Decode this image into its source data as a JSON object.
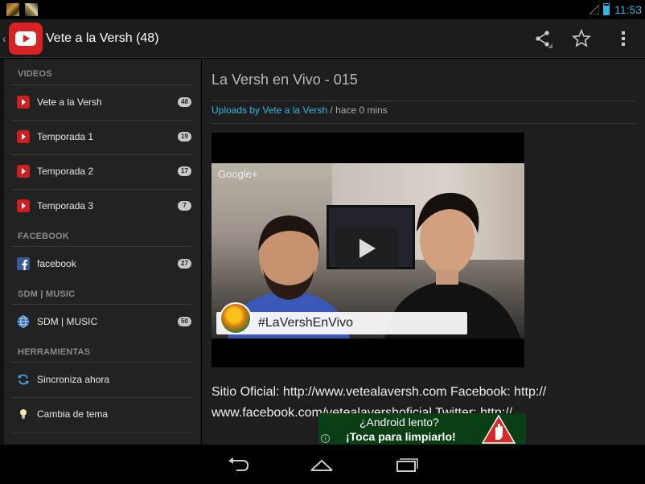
{
  "status_bar": {
    "time": "11:53",
    "notification_icons": [
      "app-notification-icon",
      "gallery-notification-icon"
    ],
    "signal_icon": "signal-icon",
    "battery_icon": "battery-icon"
  },
  "action_bar": {
    "back_icon": "chevron-left-icon",
    "app_icon": "youtube-logo-icon",
    "title": "Vete a la Versh (48)",
    "actions": [
      "share-icon",
      "star-icon",
      "overflow-menu-icon"
    ]
  },
  "sidebar": {
    "sections": [
      {
        "header": "VIDEOS",
        "items": [
          {
            "label": "Vete a la Versh",
            "count": "48",
            "icon": "youtube-icon"
          },
          {
            "label": "Temporada 1",
            "count": "19",
            "icon": "youtube-icon"
          },
          {
            "label": "Temporada 2",
            "count": "17",
            "icon": "youtube-icon"
          },
          {
            "label": "Temporada 3",
            "count": "7",
            "icon": "youtube-icon"
          }
        ]
      },
      {
        "header": "FACEBOOK",
        "items": [
          {
            "label": "facebook",
            "count": "27",
            "icon": "facebook-icon"
          }
        ]
      },
      {
        "header": "SDM | MUSIC",
        "items": [
          {
            "label": "SDM | MUSIC",
            "count": "50",
            "icon": "globe-icon"
          }
        ]
      },
      {
        "header": "HERRAMIENTAS",
        "items": [
          {
            "label": "Sincroniza ahora",
            "icon": "sync-icon"
          },
          {
            "label": "Cambia de tema",
            "icon": "lightbulb-icon"
          }
        ]
      }
    ]
  },
  "content": {
    "title": "La Versh en Vivo - 015",
    "source_link": "Uploads by Vete a la Versh",
    "meta_suffix": " / hace 0 mins",
    "video": {
      "watermark": "Google+",
      "hashtag": "#LaVershEnVivo",
      "play_icon": "play-icon"
    },
    "description_line1": "Sitio Oficial: http://www.vetealaversh.com Facebook: http://",
    "description_line2": "www.facebook.com/vetealavershoficial Twitter: http://"
  },
  "ad_banner": {
    "line1": "¿Android lento?",
    "line2": "¡Toca para limpiarlo!",
    "info_label": "i",
    "icon": "stop-hand-icon"
  },
  "nav_bar": {
    "buttons": [
      "back-nav-icon",
      "home-nav-icon",
      "recent-apps-icon"
    ]
  },
  "colors": {
    "accent": "#33b5e5",
    "youtube_red": "#cc2020",
    "ad_green": "#0a3e14",
    "sidebar_bg": "#222222",
    "content_bg": "#1e1e1e"
  }
}
